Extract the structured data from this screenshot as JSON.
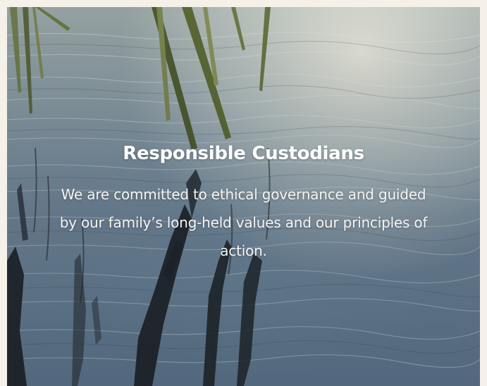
{
  "card": {
    "title": "Responsible Custodians",
    "body": "We are committed to ethical governance and guided by our family’s long-held values and our principles of action."
  },
  "colors": {
    "page_background": "#f6f1e8",
    "text": "#ffffff",
    "water_top": "#9ba7a6",
    "water_bottom": "#5a7086"
  }
}
